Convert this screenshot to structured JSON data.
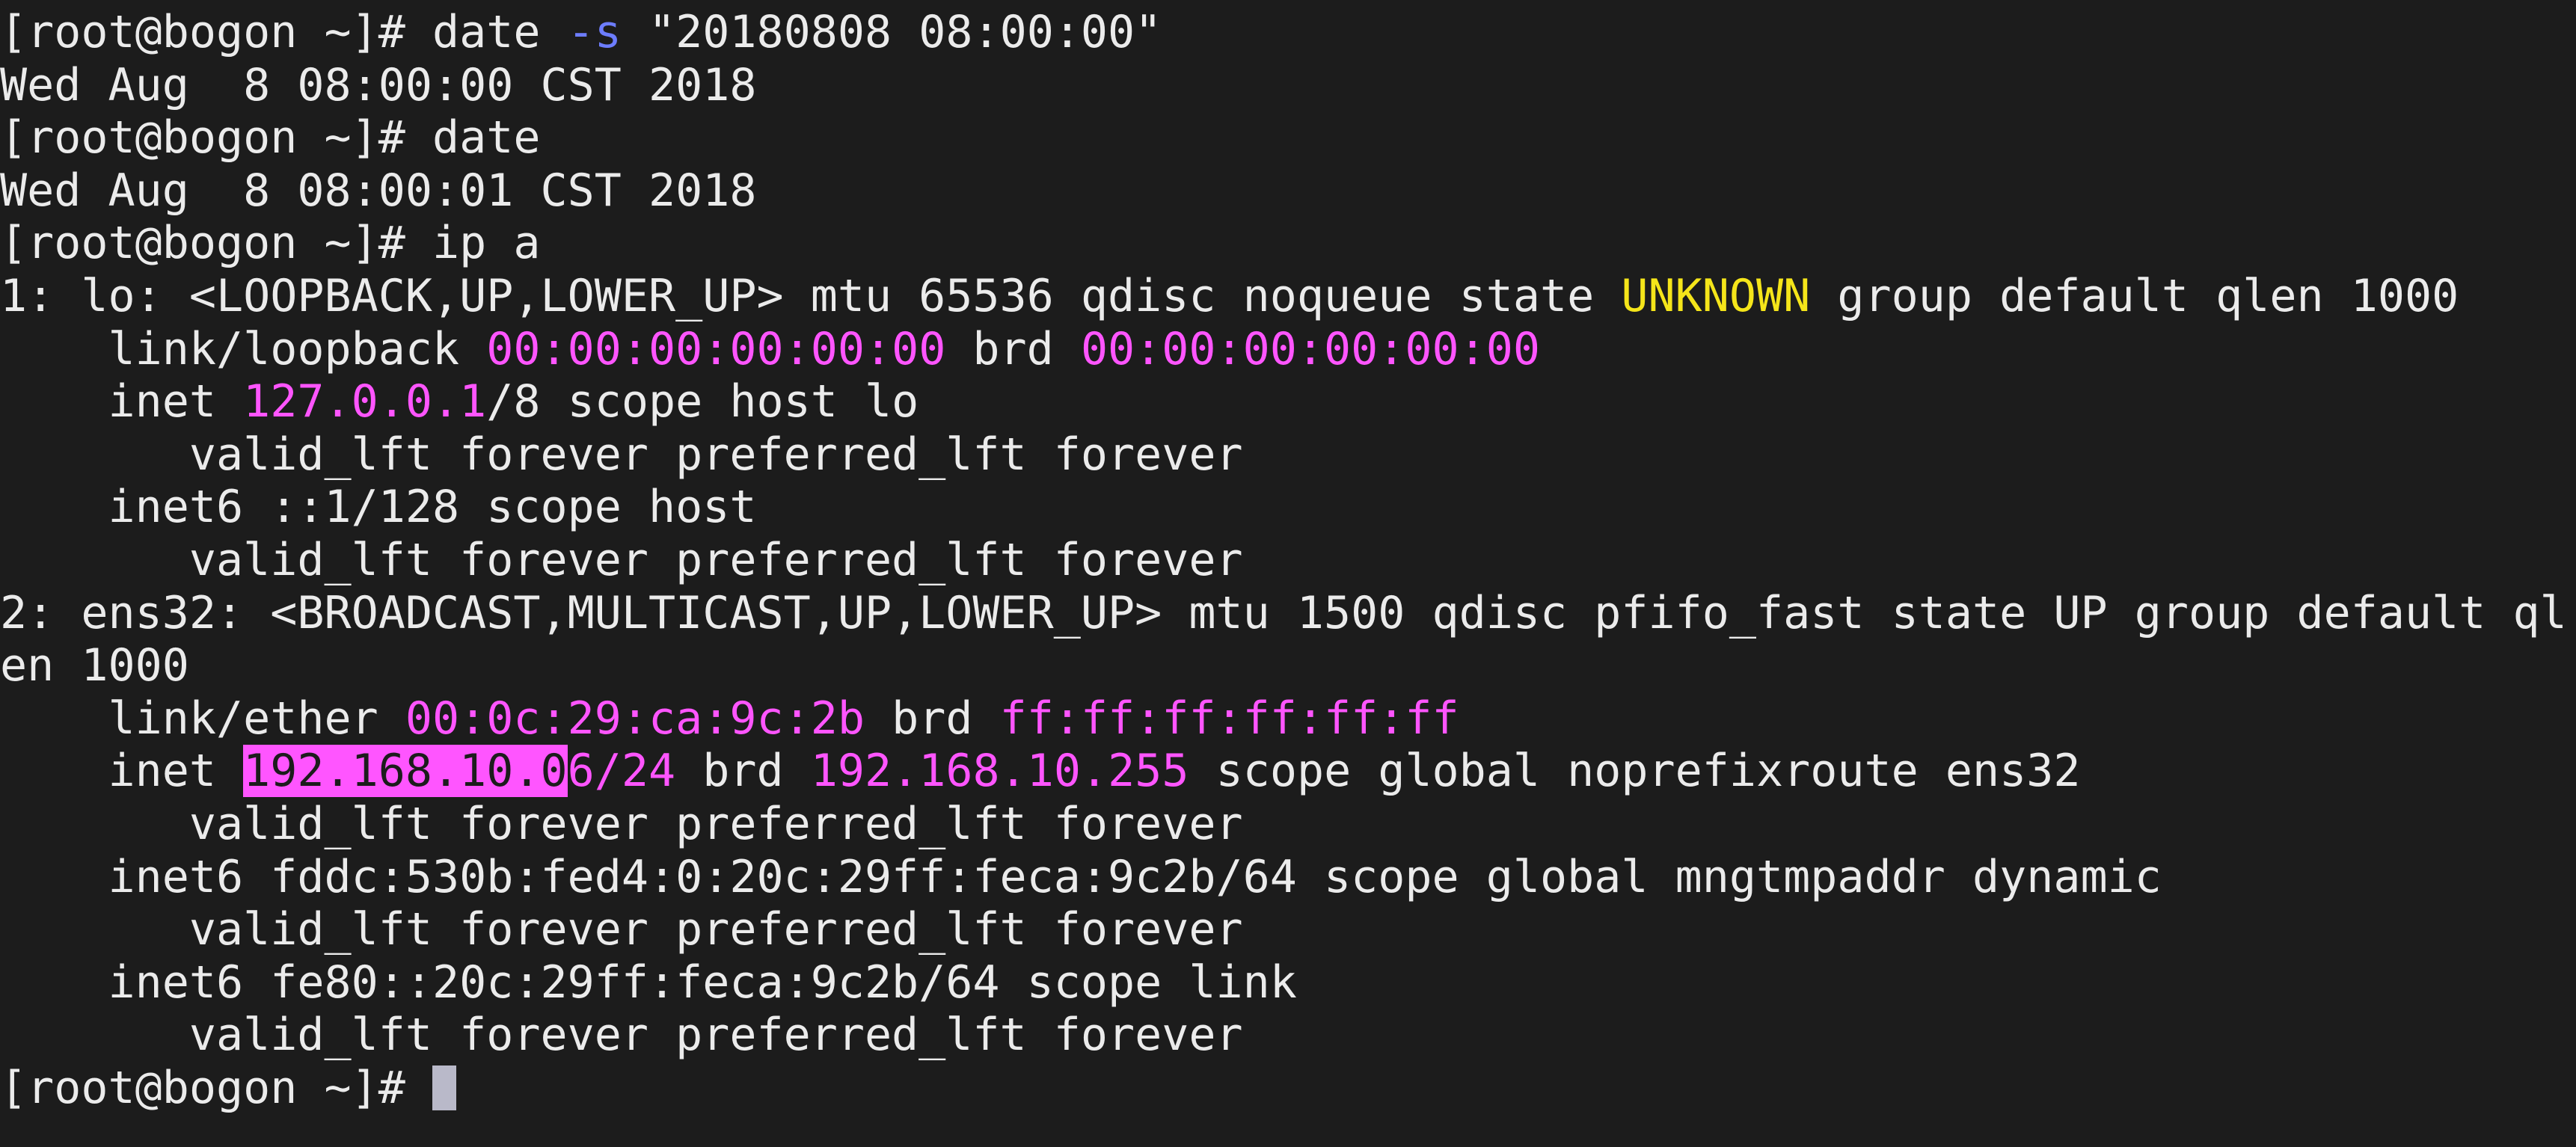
{
  "terminal": {
    "lines": [
      [
        {
          "t": "[root@bogon ~]# date "
        },
        {
          "t": "-s",
          "c": "blue"
        },
        {
          "t": " \"20180808 08:00:00\""
        }
      ],
      [
        {
          "t": "Wed Aug  8 08:00:00 CST 2018"
        }
      ],
      [
        {
          "t": "[root@bogon ~]# date"
        }
      ],
      [
        {
          "t": "Wed Aug  8 08:00:01 CST 2018"
        }
      ],
      [
        {
          "t": "[root@bogon ~]# ip a"
        }
      ],
      [
        {
          "t": "1: lo: <LOOPBACK,UP,LOWER_UP> mtu 65536 qdisc noqueue state "
        },
        {
          "t": "UNKNOWN",
          "c": "yellow"
        },
        {
          "t": " group default qlen 1000"
        }
      ],
      [
        {
          "t": "    link/loopback "
        },
        {
          "t": "00:00:00:00:00:00",
          "c": "magenta"
        },
        {
          "t": " brd "
        },
        {
          "t": "00:00:00:00:00:00",
          "c": "magenta"
        }
      ],
      [
        {
          "t": "    inet "
        },
        {
          "t": "127.0.0.1",
          "c": "magenta"
        },
        {
          "t": "/8 scope host lo"
        }
      ],
      [
        {
          "t": "       valid_lft forever preferred_lft forever"
        }
      ],
      [
        {
          "t": "    inet6 ::1/128 scope host"
        }
      ],
      [
        {
          "t": "       valid_lft forever preferred_lft forever"
        }
      ],
      [
        {
          "t": "2: ens32: <BROADCAST,MULTICAST,UP,LOWER_UP> mtu 1500 qdisc pfifo_fast state UP group default ql"
        }
      ],
      [
        {
          "t": "en 1000"
        }
      ],
      [
        {
          "t": "    link/ether "
        },
        {
          "t": "00:0c:29:ca:9c:2b",
          "c": "magenta"
        },
        {
          "t": " brd "
        },
        {
          "t": "ff:ff:ff:ff:ff:ff",
          "c": "magenta"
        }
      ],
      [
        {
          "t": "    inet "
        },
        {
          "t": "192.168.10.0",
          "c": "sel"
        },
        {
          "t": "6/24",
          "c": "magenta"
        },
        {
          "t": " brd "
        },
        {
          "t": "192.168.10.255",
          "c": "magenta"
        },
        {
          "t": " scope global noprefixroute ens32"
        }
      ],
      [
        {
          "t": "       valid_lft forever preferred_lft forever"
        }
      ],
      [
        {
          "t": "    inet6 fddc:530b:fed4:0:20c:29ff:feca:9c2b/64 scope global mngtmpaddr dynamic"
        }
      ],
      [
        {
          "t": "       valid_lft forever preferred_lft forever"
        }
      ],
      [
        {
          "t": "    inet6 fe80::20c:29ff:feca:9c2b/64 scope link"
        }
      ],
      [
        {
          "t": "       valid_lft forever preferred_lft forever"
        }
      ],
      [
        {
          "t": "[root@bogon ~]# "
        }
      ]
    ],
    "colors": {
      "background": "#1c1c1c",
      "foreground": "#ebebeb",
      "magenta": "#ff55ff",
      "yellow": "#f5e51a",
      "blue": "#6d7dff",
      "cursor": "#b9b9c9"
    }
  }
}
